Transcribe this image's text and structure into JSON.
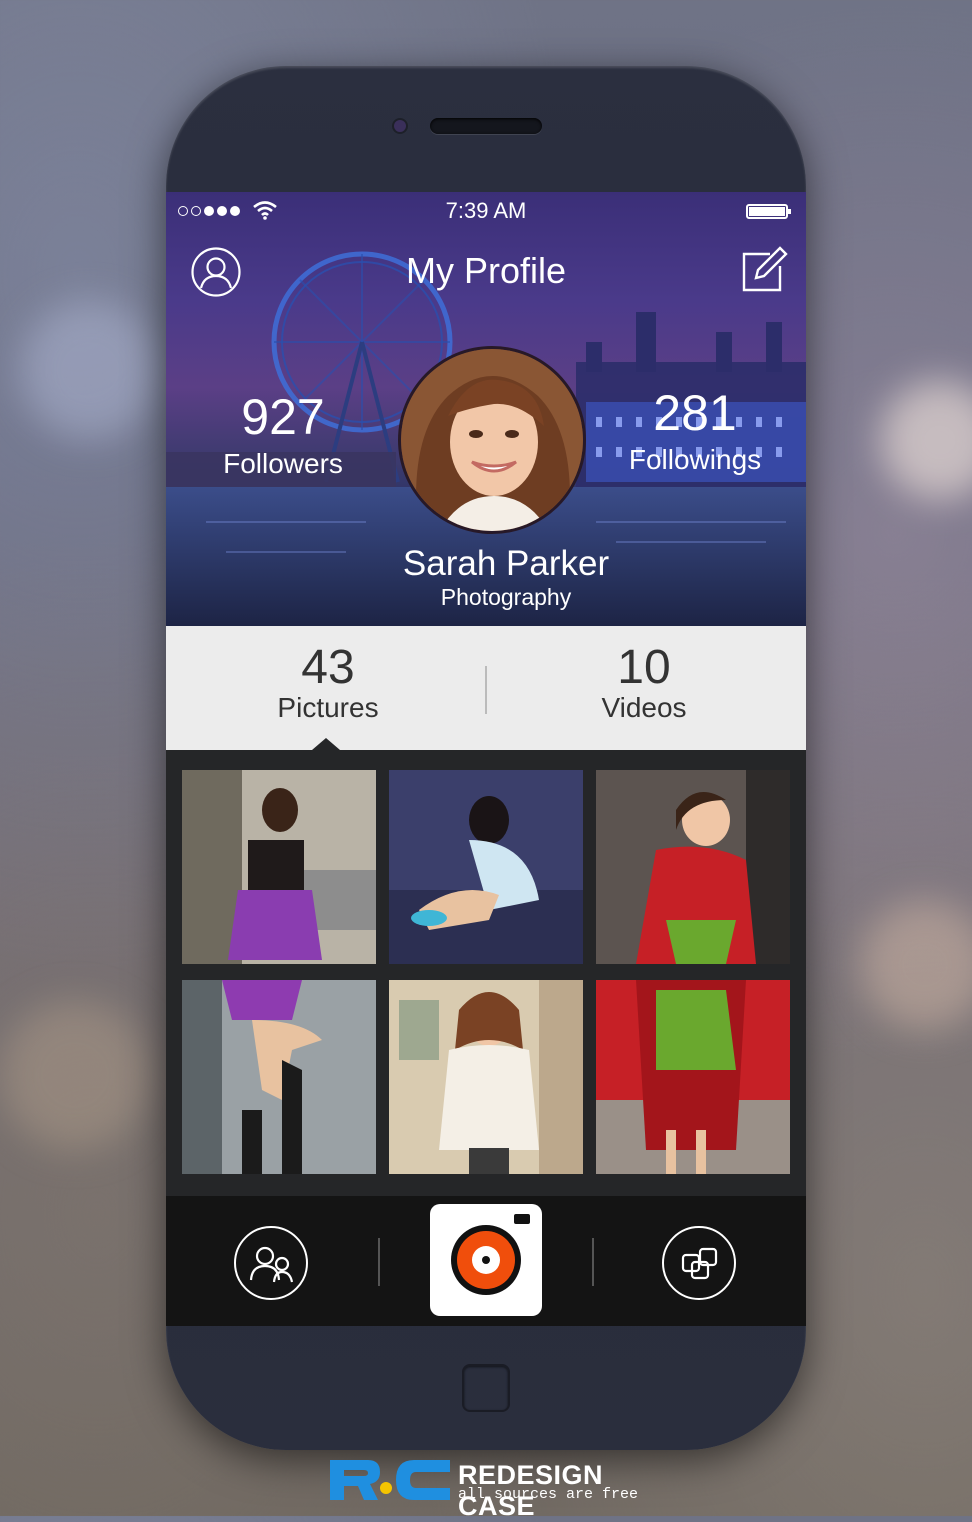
{
  "status_bar": {
    "time": "7:39 AM",
    "signal_icon": "signal-dots-icon",
    "wifi_icon": "wifi-icon",
    "battery_icon": "battery-icon"
  },
  "header": {
    "title": "My Profile",
    "left_icon": "user-icon",
    "right_icon": "edit-icon"
  },
  "profile": {
    "name": "Sarah Parker",
    "role": "Photography",
    "followers_count": "927",
    "followers_label": "Followers",
    "followings_count": "281",
    "followings_label": "Followings"
  },
  "tabs": [
    {
      "count": "43",
      "label": "Pictures",
      "selected": true
    },
    {
      "count": "10",
      "label": "Videos",
      "selected": false
    }
  ],
  "gallery": {
    "photos": [
      {
        "icon": "photo-thumbnail"
      },
      {
        "icon": "photo-thumbnail"
      },
      {
        "icon": "photo-thumbnail"
      },
      {
        "icon": "photo-thumbnail"
      },
      {
        "icon": "photo-thumbnail"
      },
      {
        "icon": "photo-thumbnail"
      }
    ]
  },
  "bottom_nav": {
    "left_icon": "friends-icon",
    "center_icon": "camera-icon",
    "right_icon": "gallery-icon"
  },
  "brand": {
    "logo": "RC",
    "name": "REDESIGN CASE",
    "tagline": "all sources are free"
  },
  "colors": {
    "accent": "#f04e0c",
    "tab_bg": "#ececec",
    "bottom_bar": "#141414",
    "brand_blue": "#1f8fe0",
    "brand_yellow": "#f5c400"
  }
}
